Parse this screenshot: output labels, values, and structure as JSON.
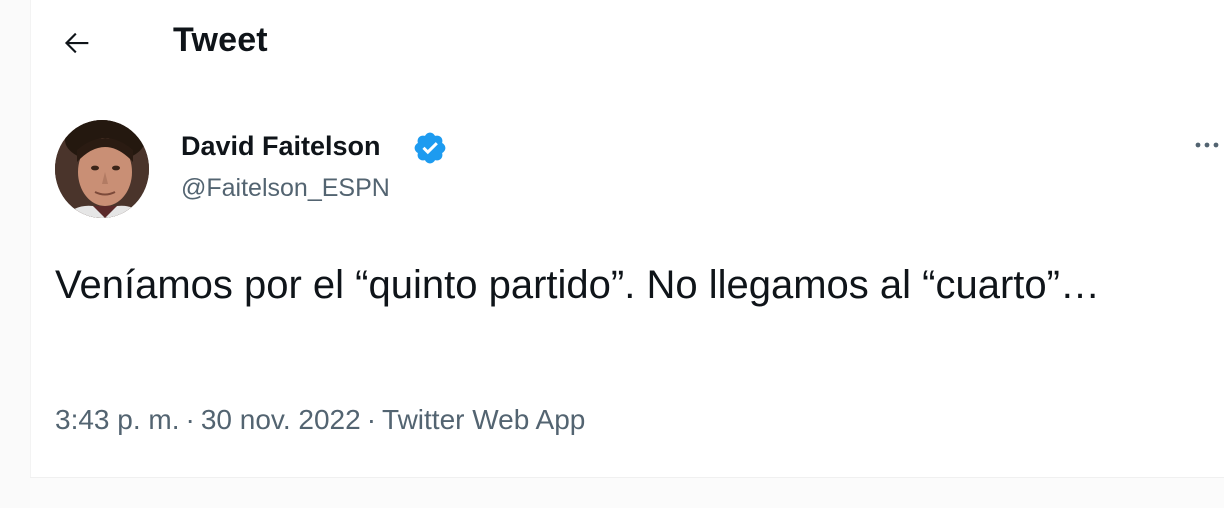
{
  "header": {
    "back_icon": "arrow-left-icon",
    "title": "Tweet"
  },
  "author": {
    "name": "David Faitelson",
    "handle": "@Faitelson_ESPN",
    "verified_icon": "verified-badge-icon",
    "verified_color": "#1d9bf0"
  },
  "more_icon": "more-horizontal-icon",
  "tweet": {
    "text": "Veníamos por el “quinto partido”. No llegamos al “cuarto”…"
  },
  "meta": {
    "time": "3:43 p. m.",
    "separator": "·",
    "date": "30 nov. 2022",
    "source": "Twitter Web App"
  },
  "colors": {
    "text_primary": "#0f1419",
    "text_secondary": "#536471",
    "accent": "#1d9bf0"
  }
}
